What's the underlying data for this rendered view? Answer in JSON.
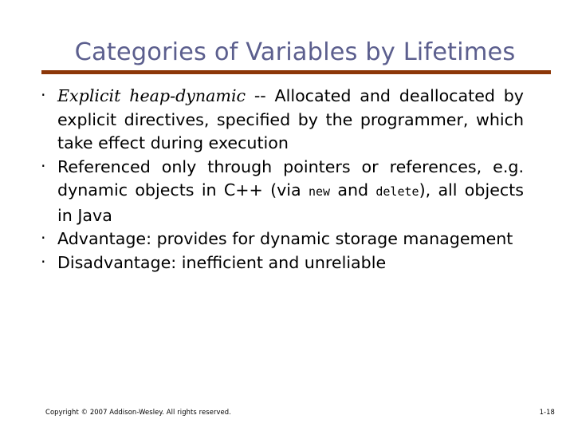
{
  "slide": {
    "title": "Categories of Variables by Lifetimes",
    "title_color": "#5c5f8e",
    "rule_color": "#8c3708",
    "background_color": "#ffffff",
    "body_text_color": "#000000",
    "bullets": [
      {
        "id": "explicit-heap-dynamic",
        "marker": "·",
        "emphasis_italic": "Explicit heap-dynamic",
        "text_rest": " -- Allocated and deallocated by explicit directives, specified by the programmer, which take effect during execution"
      },
      {
        "id": "referenced-through-pointers",
        "marker": "·",
        "part1": "Referenced only through pointers or references, e.g. dynamic objects in C++ (via ",
        "code1": "new",
        "part2": " and ",
        "code2": "delete",
        "part3": "), all objects in Java"
      },
      {
        "id": "advantage",
        "marker": "·",
        "text": "Advantage: provides for dynamic storage management"
      },
      {
        "id": "disadvantage",
        "marker": "·",
        "text": "Disadvantage: inefficient and unreliable"
      }
    ],
    "footer": {
      "copyright": "Copyright © 2007 Addison-Wesley. All rights reserved.",
      "page_number": "1-18"
    }
  }
}
